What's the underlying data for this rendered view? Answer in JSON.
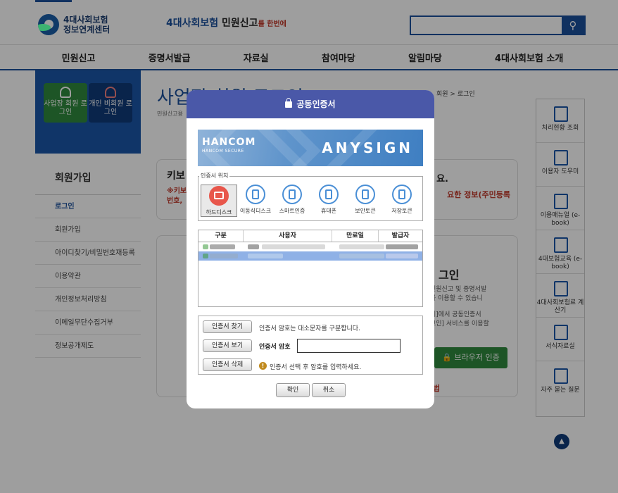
{
  "header": {
    "logo_line1": "4대사회보험",
    "logo_line2": "정보연계센터",
    "slogan_a": "4대사회보험",
    "slogan_b": "민원신고",
    "slogan_c": "를 한번에",
    "search_placeholder": ""
  },
  "gnb": [
    "민원신고",
    "증명서발급",
    "자료실",
    "참여마당",
    "알림마당",
    "4대사회보험 소개"
  ],
  "lnb": {
    "card_business": "사업장 회원 로그인",
    "card_personal": "개인 비회원 로그인",
    "title": "회원가입",
    "items": [
      "로그인",
      "회원가입",
      "아이디찾기/비밀번호재등록",
      "이용약관",
      "개인정보처리방침",
      "이메일무단수집거부",
      "정보공개제도"
    ]
  },
  "page": {
    "title": "사업장 회원 로그인",
    "sub": "민원신고용",
    "breadcrumb": "회원 > 로그인",
    "box1_title": "키보",
    "box1_right": "요.",
    "box1_red_left": "※키보\n번호,",
    "box1_red_right": "요한 정보(주민등록",
    "box2_title": "그인",
    "box2_p1": "민원신고 및 증명서발\n를 이용할 수 있습니",
    "box2_p2": "리]에서 공동인증서\n그인] 서비스를 이용할",
    "browser_btn": "브라우저 인증",
    "red_small": "법"
  },
  "quick_menu": [
    {
      "label": "처리현황 조회",
      "icon": "clipboard-icon"
    },
    {
      "label": "이용자 도우미",
      "icon": "help-monitor-icon"
    },
    {
      "label": "이용매뉴얼 (e-book)",
      "icon": "manual-edit-icon"
    },
    {
      "label": "4대보험교육 (e-book)",
      "icon": "book-icon"
    },
    {
      "label": "4대사회보험료 계산기",
      "icon": "calculator-icon"
    },
    {
      "label": "서식자료실",
      "icon": "document-icon"
    },
    {
      "label": "자주 묻는 질문",
      "icon": "chat-question-icon"
    }
  ],
  "modal": {
    "title": "공동인증서",
    "banner_brand": "HANCOM",
    "banner_brand_sub": "HANCOM SECURE",
    "banner_product": "ANYSIGN",
    "location_legend": "인증서 위치",
    "devices": [
      {
        "label": "하드디스크",
        "icon": "hard-disk-icon",
        "selected": true
      },
      {
        "label": "이동식디스크",
        "icon": "usb-drive-icon",
        "selected": false
      },
      {
        "label": "스마트인증",
        "icon": "smart-cert-icon",
        "selected": false
      },
      {
        "label": "휴대폰",
        "icon": "mobile-phone-icon",
        "selected": false
      },
      {
        "label": "보안토큰",
        "icon": "security-token-icon",
        "selected": false
      },
      {
        "label": "저장토큰",
        "icon": "storage-token-icon",
        "selected": false
      }
    ],
    "columns": [
      "구분",
      "사용자",
      "만료일",
      "발급자"
    ],
    "btn_find": "인증서 찾기",
    "btn_view": "인증서 보기",
    "btn_delete": "인증서 삭제",
    "case_note": "인증서 암호는 대소문자를 구분합니다.",
    "pw_label": "인증서 암호",
    "pw_value": "",
    "warning": "인증서 선택 후 암호를 입력하세요.",
    "ok": "확인",
    "cancel": "취소"
  },
  "colors": {
    "modal_header": "#4a58a8",
    "brand_blue": "#1b4f9c",
    "selected_row": "#8fb1e6"
  }
}
